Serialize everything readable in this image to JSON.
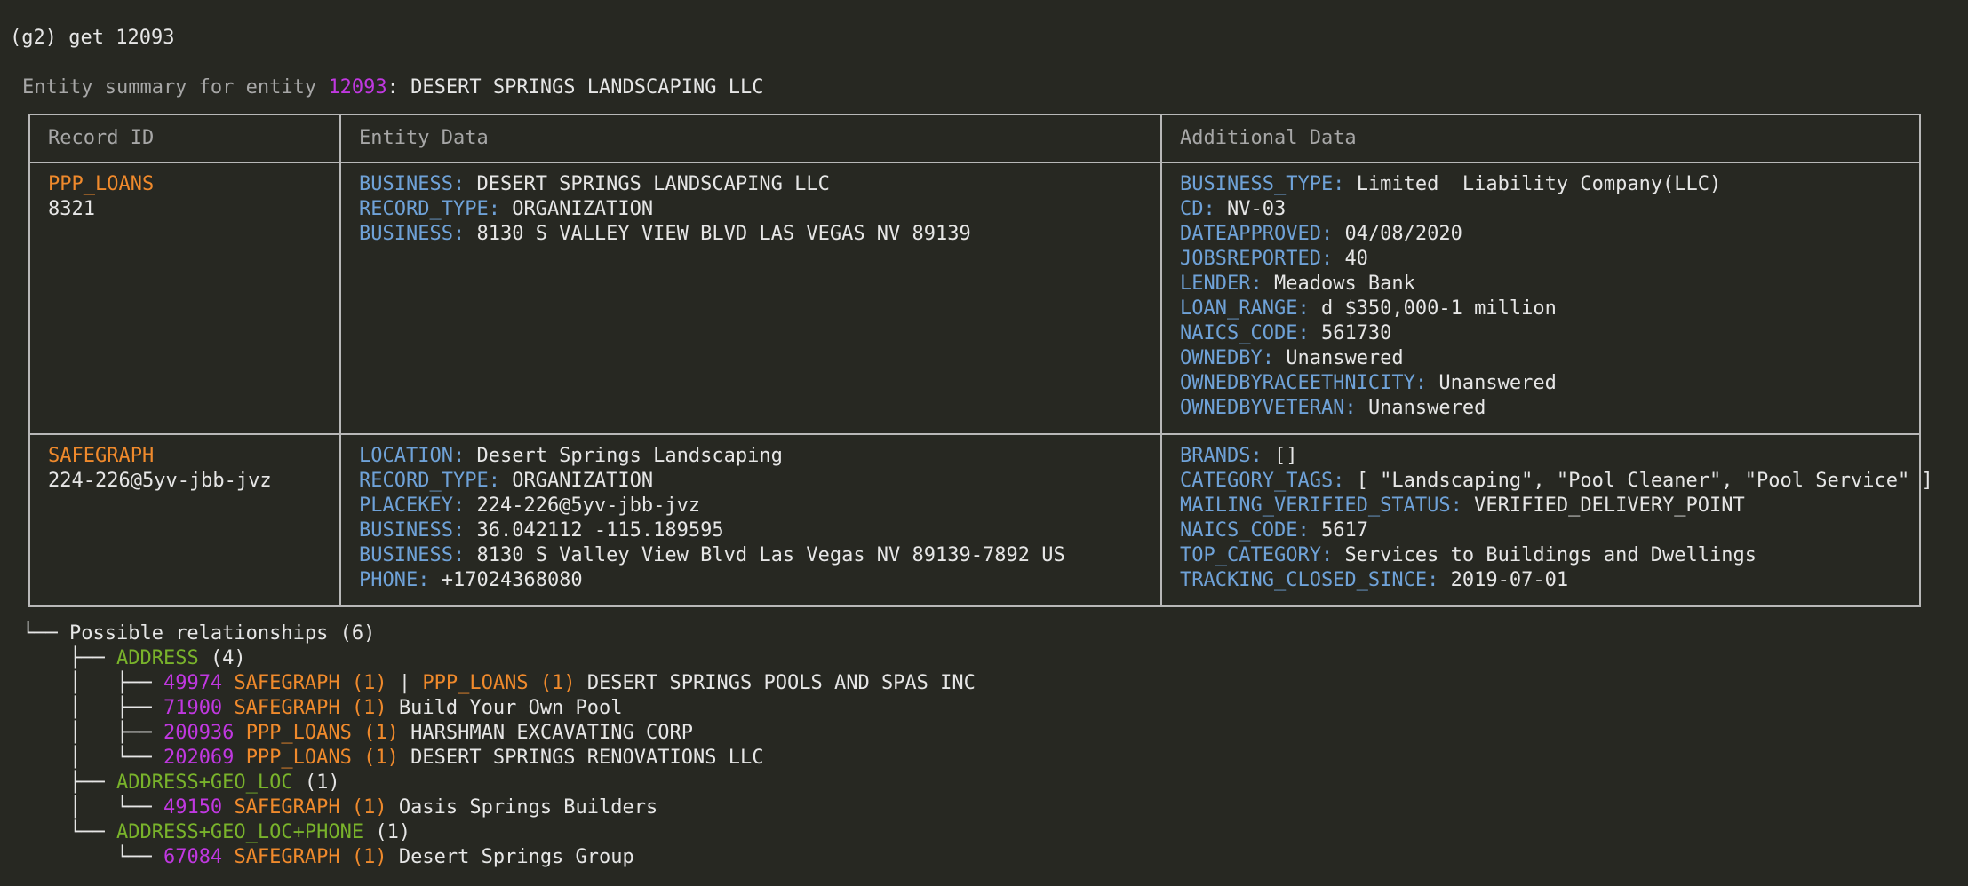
{
  "command": {
    "prompt": "(g2)",
    "text": "get 12093"
  },
  "summary": {
    "prefix": "Entity summary for entity",
    "entity_id": "12093",
    "separator": ":",
    "entity_name": "DESERT SPRINGS LANDSCAPING LLC"
  },
  "table": {
    "headers": [
      "Record ID",
      "Entity Data",
      "Additional Data"
    ],
    "rows": [
      {
        "source": "PPP_LOANS",
        "record_id": "8321",
        "entity_data": [
          {
            "key": "BUSINESS:",
            "value": "DESERT SPRINGS LANDSCAPING LLC"
          },
          {
            "key": "RECORD_TYPE:",
            "value": "ORGANIZATION"
          },
          {
            "key": "BUSINESS:",
            "value": "8130 S VALLEY VIEW BLVD LAS VEGAS NV 89139"
          }
        ],
        "additional_data": [
          {
            "key": "BUSINESS_TYPE:",
            "value": "Limited  Liability Company(LLC)"
          },
          {
            "key": "CD:",
            "value": "NV-03"
          },
          {
            "key": "DATEAPPROVED:",
            "value": "04/08/2020"
          },
          {
            "key": "JOBSREPORTED:",
            "value": "40"
          },
          {
            "key": "LENDER:",
            "value": "Meadows Bank"
          },
          {
            "key": "LOAN_RANGE:",
            "value": "d $350,000-1 million"
          },
          {
            "key": "NAICS_CODE:",
            "value": "561730"
          },
          {
            "key": "OWNEDBY:",
            "value": "Unanswered"
          },
          {
            "key": "OWNEDBYRACEETHNICITY:",
            "value": "Unanswered"
          },
          {
            "key": "OWNEDBYVETERAN:",
            "value": "Unanswered"
          }
        ]
      },
      {
        "source": "SAFEGRAPH",
        "record_id": "224-226@5yv-jbb-jvz",
        "entity_data": [
          {
            "key": "LOCATION:",
            "value": "Desert Springs Landscaping"
          },
          {
            "key": "RECORD_TYPE:",
            "value": "ORGANIZATION"
          },
          {
            "key": "PLACEKEY:",
            "value": "224-226@5yv-jbb-jvz"
          },
          {
            "key": "BUSINESS:",
            "value": "36.042112 -115.189595"
          },
          {
            "key": "BUSINESS:",
            "value": "8130 S Valley View Blvd Las Vegas NV 89139-7892 US"
          },
          {
            "key": "PHONE:",
            "value": "+17024368080"
          }
        ],
        "additional_data": [
          {
            "key": "BRANDS:",
            "value": "[]"
          },
          {
            "key": "CATEGORY_TAGS:",
            "value": "[ \"Landscaping\", \"Pool Cleaner\", \"Pool Service\" ]"
          },
          {
            "key": "MAILING_VERIFIED_STATUS:",
            "value": "VERIFIED_DELIVERY_POINT"
          },
          {
            "key": "NAICS_CODE:",
            "value": "5617"
          },
          {
            "key": "TOP_CATEGORY:",
            "value": "Services to Buildings and Dwellings"
          },
          {
            "key": "TRACKING_CLOSED_SINCE:",
            "value": "2019-07-01"
          }
        ]
      }
    ]
  },
  "relationships": {
    "root_branch": "└── ",
    "title": "Possible relationships (6)",
    "groups": [
      {
        "branch": "├── ",
        "name": "ADDRESS",
        "count": "(4)",
        "items": [
          {
            "branch": "├── ",
            "id": "49974",
            "src1": "SAFEGRAPH (1)",
            "sep": " | ",
            "src2": "PPP_LOANS (1)",
            "name": "DESERT SPRINGS POOLS AND SPAS INC"
          },
          {
            "branch": "├── ",
            "id": "71900",
            "src1": "SAFEGRAPH (1)",
            "name": "Build Your Own Pool"
          },
          {
            "branch": "├── ",
            "id": "200936",
            "src1": "PPP_LOANS (1)",
            "name": "HARSHMAN EXCAVATING CORP"
          },
          {
            "branch": "└── ",
            "id": "202069",
            "src1": "PPP_LOANS (1)",
            "name": "DESERT SPRINGS RENOVATIONS LLC"
          }
        ]
      },
      {
        "branch": "├── ",
        "name": "ADDRESS+GEO_LOC",
        "count": "(1)",
        "items": [
          {
            "branch": "└── ",
            "id": "49150",
            "src1": "SAFEGRAPH (1)",
            "name": "Oasis Springs Builders"
          }
        ]
      },
      {
        "branch": "└── ",
        "name": "ADDRESS+GEO_LOC+PHONE",
        "count": "(1)",
        "items": [
          {
            "branch": "└── ",
            "id": "67084",
            "src1": "SAFEGRAPH (1)",
            "name": "Desert Springs Group"
          }
        ]
      }
    ]
  }
}
